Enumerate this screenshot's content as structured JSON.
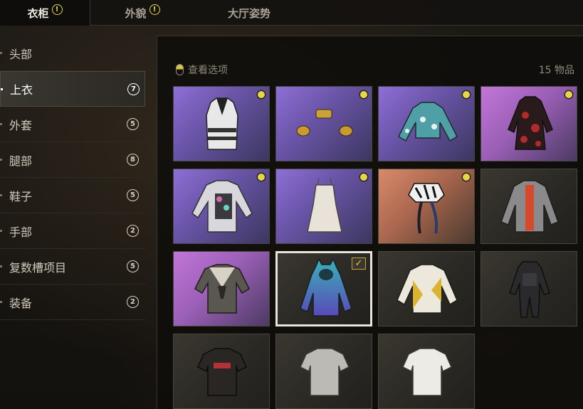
{
  "tabs": [
    {
      "label": "衣柜",
      "alert": true,
      "active": true
    },
    {
      "label": "外貌",
      "alert": true,
      "active": false
    },
    {
      "label": "大厅姿势",
      "alert": false,
      "active": false
    }
  ],
  "alert_symbol": "!",
  "sidebar": {
    "items": [
      {
        "label": "头部",
        "count": ""
      },
      {
        "label": "上衣",
        "count": "7",
        "active": true
      },
      {
        "label": "外套",
        "count": "5"
      },
      {
        "label": "腿部",
        "count": "8"
      },
      {
        "label": "鞋子",
        "count": "5"
      },
      {
        "label": "手部",
        "count": "2"
      },
      {
        "label": "复数槽项目",
        "count": "5"
      },
      {
        "label": "装备",
        "count": "2"
      }
    ]
  },
  "toolbar": {
    "view_options": "查看选项",
    "item_count": "15 物品"
  },
  "items": [
    {
      "name": "white-harness-vest",
      "bg": "purple",
      "new": true
    },
    {
      "name": "gold-cuffs",
      "bg": "purple",
      "new": true
    },
    {
      "name": "teal-floral-jacket",
      "bg": "purple",
      "new": true
    },
    {
      "name": "red-floral-dress",
      "bg": "pink",
      "new": true
    },
    {
      "name": "floral-shirt-vest",
      "bg": "purple",
      "new": true
    },
    {
      "name": "white-slip-dress",
      "bg": "purple",
      "new": true
    },
    {
      "name": "zebra-ribbon-top",
      "bg": "orange",
      "new": true
    },
    {
      "name": "grey-orange-jacket",
      "bg": "dark",
      "new": false
    },
    {
      "name": "sailor-shirt",
      "bg": "pink",
      "new": false
    },
    {
      "name": "teal-purple-hoodie",
      "bg": "dark",
      "new": false,
      "selected": true
    },
    {
      "name": "yellow-white-jacket",
      "bg": "dark",
      "new": false
    },
    {
      "name": "black-tactical-suit",
      "bg": "dark",
      "new": false
    },
    {
      "name": "black-graphic-tee",
      "bg": "dark",
      "new": false
    },
    {
      "name": "grey-tee",
      "bg": "dark",
      "new": false
    },
    {
      "name": "white-tee",
      "bg": "dark",
      "new": false
    }
  ],
  "colors": {
    "accent_yellow": "#e6d64a",
    "check_mark": "#e8c84a"
  }
}
